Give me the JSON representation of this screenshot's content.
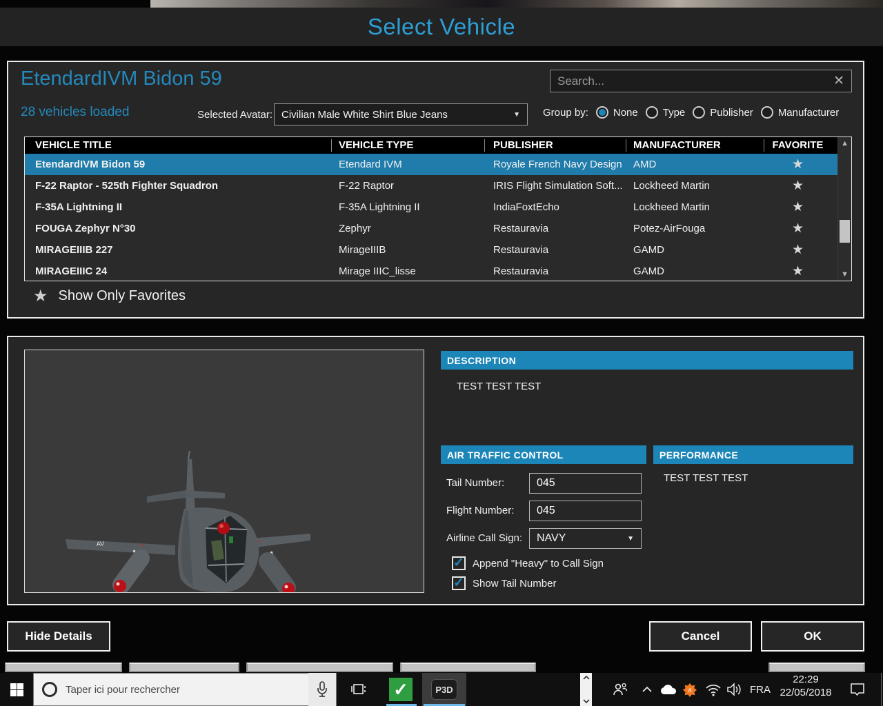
{
  "header": {
    "title": "Select Vehicle"
  },
  "dialog": {
    "selected_vehicle_title": "EtendardIVM Bidon 59",
    "vehicles_loaded": "28 vehicles loaded",
    "selected_avatar_label": "Selected Avatar:",
    "selected_avatar_value": "Civilian Male White Shirt Blue Jeans",
    "search_placeholder": "Search...",
    "search_clear_glyph": "✕",
    "group_by": {
      "label": "Group by:",
      "options": [
        {
          "label": "None",
          "selected": true
        },
        {
          "label": "Type",
          "selected": false
        },
        {
          "label": "Publisher",
          "selected": false
        },
        {
          "label": "Manufacturer",
          "selected": false
        }
      ]
    },
    "table": {
      "columns": [
        "VEHICLE TITLE",
        "VEHICLE TYPE",
        "PUBLISHER",
        "MANUFACTURER",
        "FAVORITE"
      ],
      "rows": [
        {
          "title": "EtendardIVM Bidon 59",
          "type": "Etendard IVM",
          "publisher": "Royale French Navy Design",
          "manufacturer": "AMD",
          "favorite": true,
          "selected": true
        },
        {
          "title": "F-22 Raptor - 525th Fighter Squadron",
          "type": "F-22 Raptor",
          "publisher": "IRIS Flight Simulation Soft...",
          "manufacturer": "Lockheed Martin",
          "favorite": true,
          "selected": false
        },
        {
          "title": "F-35A Lightning II",
          "type": "F-35A Lightning II",
          "publisher": "IndiaFoxtEcho",
          "manufacturer": "Lockheed Martin",
          "favorite": true,
          "selected": false
        },
        {
          "title": "FOUGA Zephyr N°30",
          "type": "Zephyr",
          "publisher": "Restauravia",
          "manufacturer": "Potez-AirFouga",
          "favorite": true,
          "selected": false
        },
        {
          "title": "MIRAGEIIIB 227",
          "type": "MirageIIIB",
          "publisher": "Restauravia",
          "manufacturer": "GAMD",
          "favorite": true,
          "selected": false
        },
        {
          "title": "MIRAGEIIIC 24",
          "type": "Mirage IIIC_lisse",
          "publisher": "Restauravia",
          "manufacturer": "GAMD",
          "favorite": true,
          "selected": false
        }
      ],
      "favorite_star_glyph": "★"
    },
    "show_only_favorites": "Show Only Favorites"
  },
  "details": {
    "description": {
      "header": "DESCRIPTION",
      "text": "TEST TEST TEST"
    },
    "atc": {
      "header": "AIR TRAFFIC CONTROL",
      "tail_number_label": "Tail Number:",
      "tail_number": "045",
      "flight_number_label": "Flight Number:",
      "flight_number": "045",
      "airline_call_sign_label": "Airline Call Sign:",
      "airline_call_sign": "NAVY",
      "append_heavy_label": "Append \"Heavy\" to Call Sign",
      "append_heavy_checked": true,
      "show_tail_label": "Show Tail Number",
      "show_tail_checked": true,
      "check_glyph": "✓"
    },
    "performance": {
      "header": "PERFORMANCE",
      "text": "TEST TEST TEST"
    }
  },
  "buttons": {
    "hide_details": "Hide Details",
    "cancel": "Cancel",
    "ok": "OK"
  },
  "taskbar": {
    "search_placeholder": "Taper ici pour rechercher",
    "p3d_label": "P3D",
    "language": "FRA",
    "time": "22:29",
    "date": "22/05/2018"
  },
  "colors": {
    "accent_blue": "#1d86b8",
    "selected_row_blue": "#1f7cab",
    "title_blue": "#2c9fd6",
    "heading_blue": "#2489bb",
    "running_underline": "#6cb8e8",
    "avast_orange": "#f47a20",
    "check_green": "#2f9e41",
    "tank_red": "#bd1016"
  }
}
